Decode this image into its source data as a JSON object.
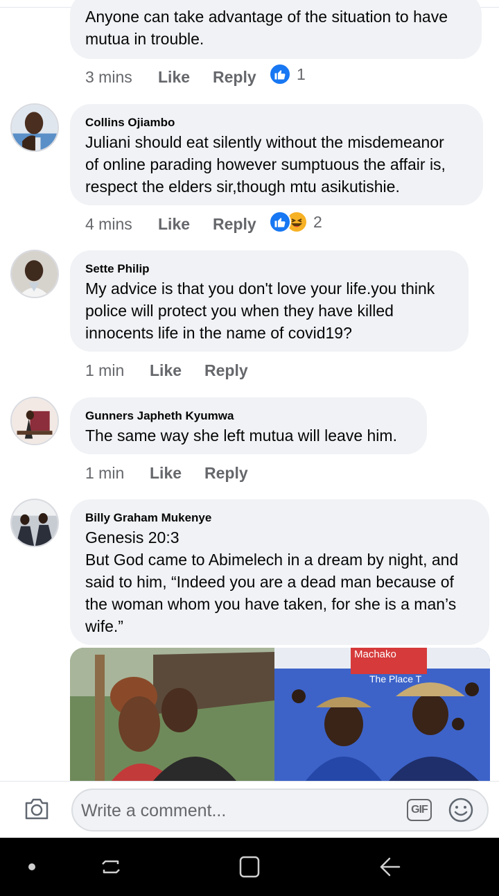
{
  "comments": [
    {
      "author": "",
      "text": "Anyone can take advantage of the situation to have\nmutua in trouble.",
      "time": "3 mins",
      "like_label": "Like",
      "reply_label": "Reply",
      "reactions": [
        "like-icon"
      ],
      "reaction_count": "1"
    },
    {
      "author": "Collins Ojiambo",
      "text": "Juliani should eat silently without the misdemeanor\nof online parading however sumptuous the affair is,\nrespect the elders sir,though mtu asikutishie.",
      "time": "4 mins",
      "like_label": "Like",
      "reply_label": "Reply",
      "reactions": [
        "like-icon",
        "haha-icon"
      ],
      "reaction_count": "2"
    },
    {
      "author": "Sette Philip",
      "text": "My advice is that you don't love your life.you think\npolice will protect you when they have killed\ninnocents life in the name of covid19?",
      "time": "1 min",
      "like_label": "Like",
      "reply_label": "Reply"
    },
    {
      "author": "Gunners Japheth Kyumwa",
      "text": "The same way she left mutua will leave him.",
      "time": "1 min",
      "like_label": "Like",
      "reply_label": "Reply"
    },
    {
      "author": "Billy Graham Mukenye",
      "text": "Genesis 20:3\nBut God came to Abimelech in a dream by night, and\nsaid to him, “Indeed you are a dead man because of\nthe woman whom you have taken, for she is a man’s\nwife.”"
    }
  ],
  "attachment": {
    "banner_text": "Machako",
    "banner_sub": "The Place T"
  },
  "composer": {
    "placeholder": "Write a comment...",
    "gif_label": "GIF",
    "camera_icon": "camera-icon",
    "emoji_icon": "emoji-icon"
  },
  "navbar": {
    "icons": [
      "dot-icon",
      "recent-apps-icon",
      "home-icon",
      "back-icon"
    ]
  },
  "colors": {
    "bubble": "#f0f2f5",
    "like_blue": "#1877f2",
    "meta_gray": "#65676b"
  }
}
